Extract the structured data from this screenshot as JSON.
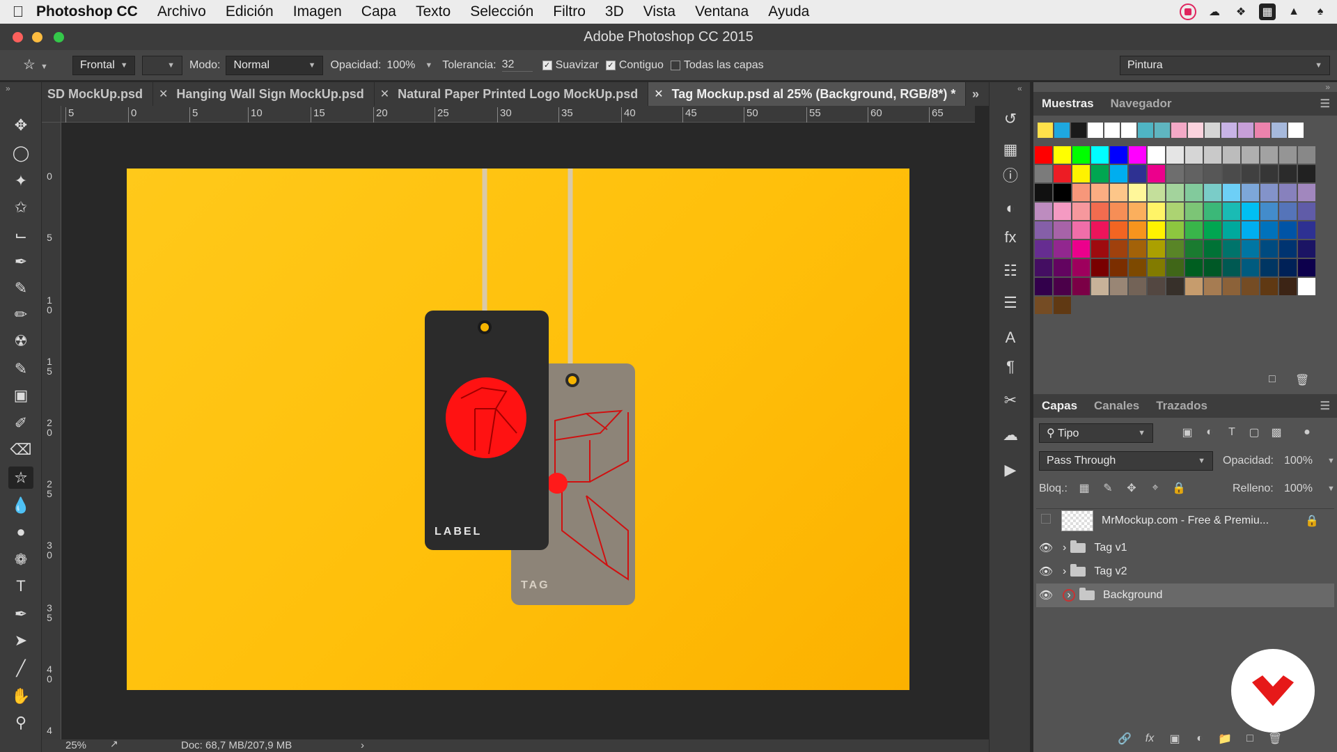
{
  "menubar": {
    "app": "Photoshop CC",
    "items": [
      "Archivo",
      "Edición",
      "Imagen",
      "Capa",
      "Texto",
      "Selección",
      "Filtro",
      "3D",
      "Vista",
      "Ventana",
      "Ayuda"
    ]
  },
  "window": {
    "title": "Adobe Photoshop CC 2015"
  },
  "options": {
    "orientation": "Frontal",
    "mode_label": "Modo:",
    "mode_value": "Normal",
    "opacity_label": "Opacidad:",
    "opacity_value": "100%",
    "tolerance_label": "Tolerancia:",
    "tolerance_value": "32",
    "antialias_label": "Suavizar",
    "contiguous_label": "Contiguo",
    "all_layers_label": "Todas las capas",
    "workspace": "Pintura"
  },
  "tabs": [
    {
      "label": "SD MockUp.psd"
    },
    {
      "label": "Hanging Wall Sign MockUp.psd"
    },
    {
      "label": "Natural Paper Printed Logo MockUp.psd"
    },
    {
      "label": "Tag Mockup.psd al 25% (Background, RGB/8*) *"
    }
  ],
  "ruler": {
    "top": [
      "5",
      "0",
      "5",
      "10",
      "15",
      "20",
      "25",
      "30",
      "35",
      "40",
      "45",
      "50",
      "55",
      "60",
      "65"
    ],
    "left": [
      "0",
      "5",
      "1 0",
      "1 5",
      "2 0",
      "2 5",
      "3 0",
      "3 5",
      "4 0",
      "4"
    ]
  },
  "document": {
    "tag_dark_text": "LABEL",
    "tag_grey_text": "TAG"
  },
  "status": {
    "zoom": "25%",
    "doc": "Doc: 68,7 MB/207,9 MB"
  },
  "swatches_panel": {
    "tabs": [
      "Muestras",
      "Navegador"
    ],
    "recent": [
      "#ffe14a",
      "#1ea8e0",
      "#1a1a1a",
      "#ffffff",
      "#ffffff",
      "#ffffff",
      "#4fb5c4",
      "#5fb5c0",
      "#f4a9c7",
      "#fbd3de",
      "#d5d5d5",
      "#c8b3e6",
      "#c79fd8",
      "#ec83ad",
      "#a6b9dc",
      "#ffffff"
    ],
    "grid": [
      [
        "#ff0000",
        "#ffff00",
        "#00ff00",
        "#00ffff",
        "#0000ff",
        "#ff00ff",
        "#ffffff",
        "#e5e5e5",
        "#d6d6d6",
        "#c9c9c9",
        "#bcbcbc",
        "#afafaf",
        "#a2a2a2",
        "#959595",
        "#888888"
      ],
      [
        "#7b7b7b",
        "#ed1c24",
        "#fff200",
        "#00a651",
        "#00aeef",
        "#2e3192",
        "#ec008c",
        "#6e6e6e",
        "#626262",
        "#575757",
        "#4b4b4b",
        "#404040",
        "#363636",
        "#2b2b2b",
        "#212121"
      ],
      [
        "#111111",
        "#000000",
        "#f7977a",
        "#fbad82",
        "#fdc689",
        "#fff79a",
        "#c4df9b",
        "#a3d39c",
        "#82ca9c",
        "#7accc8",
        "#6dcff6",
        "#7da7d9",
        "#8393ca",
        "#8781bd",
        "#a187be"
      ],
      [
        "#bd8cbf",
        "#f49ac2",
        "#f6989d",
        "#f26c4f",
        "#f68e56",
        "#fbaf5d",
        "#fff467",
        "#acd372",
        "#7cc576",
        "#3bb878",
        "#1abbb4",
        "#00bff3",
        "#438ccb",
        "#5574b9",
        "#605ca8"
      ],
      [
        "#855fa8",
        "#a763a8",
        "#f06ea9",
        "#ed145b",
        "#f26522",
        "#f7941d",
        "#fff200",
        "#8dc63f",
        "#39b54a",
        "#00a651",
        "#00a99d",
        "#00aeef",
        "#0072bc",
        "#0054a6",
        "#2e3192"
      ],
      [
        "#662d91",
        "#92278f",
        "#ec008c",
        "#9e0b0f",
        "#a0410d",
        "#a36209",
        "#aba000",
        "#598527",
        "#1a7b30",
        "#007236",
        "#00746b",
        "#0076a3",
        "#004b80",
        "#003471",
        "#1b1464"
      ],
      [
        "#440e62",
        "#630460",
        "#9e005d",
        "#790000",
        "#7b2e00",
        "#7d4900",
        "#827b00",
        "#406618",
        "#005e20",
        "#005826",
        "#005952",
        "#005b7f",
        "#003663",
        "#002157",
        "#0d004c"
      ],
      [
        "#32004b",
        "#4b0049",
        "#7b0046",
        "#c7b299",
        "#998675",
        "#736357",
        "#534741",
        "#37302a",
        "#c69c6d",
        "#a67c52",
        "#8c6239",
        "#754c24",
        "#603913",
        "#3c2415",
        "#ffffff"
      ],
      [
        "#754c24",
        "#603913"
      ]
    ]
  },
  "layers_panel": {
    "tabs": [
      "Capas",
      "Canales",
      "Trazados"
    ],
    "filter": "Tipo",
    "blend_mode": "Pass Through",
    "opacity_label": "Opacidad:",
    "opacity_value": "100%",
    "lock_label": "Bloq.:",
    "fill_label": "Relleno:",
    "fill_value": "100%",
    "layers": [
      {
        "name": "MrMockup.com - Free & Premiu...",
        "visible": false,
        "type": "smart"
      },
      {
        "name": "Tag v1",
        "visible": true,
        "type": "group"
      },
      {
        "name": "Tag v2",
        "visible": true,
        "type": "group"
      },
      {
        "name": "Background",
        "visible": true,
        "type": "group",
        "selected": true
      }
    ]
  }
}
